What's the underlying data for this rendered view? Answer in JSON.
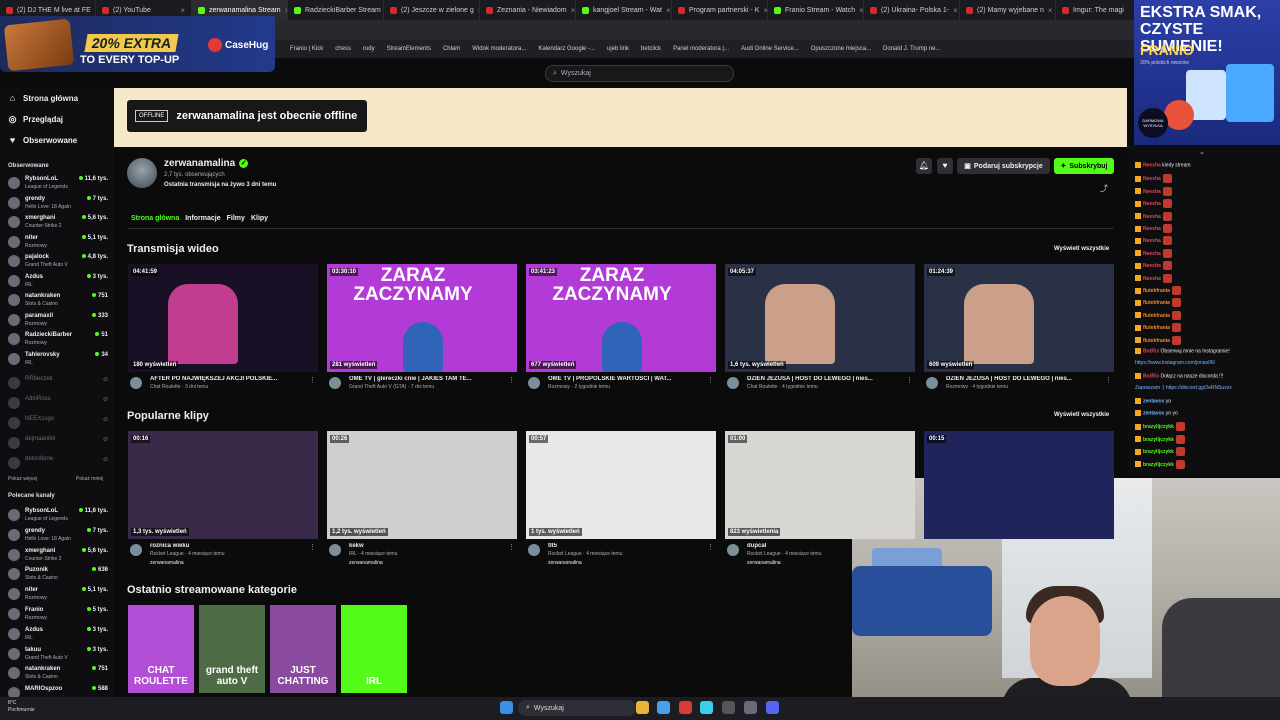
{
  "browser": {
    "tabs": [
      {
        "label": "(2) DJ THE M live at FE",
        "icon": "youtube-icon"
      },
      {
        "label": "(2) YouTube",
        "icon": "youtube-icon"
      },
      {
        "label": "zerwanamalina Stream",
        "icon": "kick-icon",
        "active": true
      },
      {
        "label": "RadzieckiBarber Stream",
        "icon": "kick-icon"
      },
      {
        "label": "(2) Jeszcze w zielone g",
        "icon": "youtube-icon"
      },
      {
        "label": "Zeznania - Niewiadom",
        "icon": "tiktok-icon"
      },
      {
        "label": "kangjoel Stream - Wat",
        "icon": "kick-icon"
      },
      {
        "label": "Program partnerski - K",
        "icon": "youtube-icon"
      },
      {
        "label": "Franio Stream - Watch",
        "icon": "kick-icon"
      },
      {
        "label": "(2) Ukraina- Polska 1-",
        "icon": "youtube-icon"
      },
      {
        "label": "(2) Mamy wyjebane n",
        "icon": "youtube-icon"
      },
      {
        "label": "Imgur: The magi",
        "icon": "imgur-icon"
      }
    ],
    "bookmarks": [
      "Franio | Kick",
      "chess",
      "rudy",
      "StreamElements",
      "Chłam",
      "Widok moderatora...",
      "Kalendarz Google -...",
      "ujeb link",
      "betclick",
      "Panel moderatora |...",
      "Audi Online Service...",
      "Opuszczone miejsca...",
      "Donald J. Trump ne..."
    ]
  },
  "promo": {
    "headline": "20% EXTRA",
    "sub": "TO EVERY TOP-UP",
    "brand": "CaseHug"
  },
  "ad": {
    "headline": "EKSTRA SMAK, CZYSTE SUMIENIE!",
    "brand": "FRANIO",
    "fine": "30% polskich owoców",
    "badge": "DARMOWA WYSYŁKA"
  },
  "search": {
    "placeholder": "Wyszukaj"
  },
  "nav": {
    "home": "Strona główna",
    "browse": "Przeglądaj",
    "following": "Obserwowane",
    "following_header": "Obserwowane",
    "show_more": "Pokaż więcej",
    "show_less": "Pokaż mniej",
    "recommended_header": "Polecane kanały",
    "followed": [
      {
        "name": "RybsonLoL",
        "category": "League of Legends",
        "viewers": "11,6 tys."
      },
      {
        "name": "grendy",
        "category": "Hello Love: 18 Again",
        "viewers": "7 tys."
      },
      {
        "name": "xmerghani",
        "category": "Counter-Strike 2",
        "viewers": "5,6 tys."
      },
      {
        "name": "niter",
        "category": "Rozmowy",
        "viewers": "5,1 tys."
      },
      {
        "name": "pajalock",
        "category": "Grand Theft Auto V",
        "viewers": "4,8 tys."
      },
      {
        "name": "Azdus",
        "category": "IRL",
        "viewers": "3 tys."
      },
      {
        "name": "natankraken",
        "category": "Slots & Casino",
        "viewers": "751"
      },
      {
        "name": "paramaxil",
        "category": "Rozmowy",
        "viewers": "333"
      },
      {
        "name": "RadzieckiBarber",
        "category": "Rozmowy",
        "viewers": "51"
      },
      {
        "name": "Tahlerovsky",
        "category": "IRL",
        "viewers": "34"
      }
    ],
    "followed_offline": [
      "RRbeczek",
      "AdinRoss",
      "NEEXcsgo",
      "dejmaanikk",
      "delordione"
    ],
    "recommended": [
      {
        "name": "RybsonLoL",
        "category": "League of Legends",
        "viewers": "11,6 tys."
      },
      {
        "name": "grendy",
        "category": "Hello Love: 18 Again",
        "viewers": "7 tys."
      },
      {
        "name": "xmerghani",
        "category": "Counter-Strike 2",
        "viewers": "5,6 tys."
      },
      {
        "name": "Puzonik",
        "category": "Slots & Casino",
        "viewers": "636"
      },
      {
        "name": "niter",
        "category": "Rozmowy",
        "viewers": "5,1 tys."
      },
      {
        "name": "Franio",
        "category": "Rozmowy",
        "viewers": "5 tys."
      },
      {
        "name": "Azdus",
        "category": "IRL",
        "viewers": "3 tys."
      },
      {
        "name": "takuu",
        "category": "Grand Theft Auto V",
        "viewers": "3 tys."
      },
      {
        "name": "natankraken",
        "category": "Slots & Casino",
        "viewers": "751"
      },
      {
        "name": "MARIOspzoo",
        "category": "",
        "viewers": "588"
      }
    ]
  },
  "channel": {
    "offline_tag": "OFFLINE",
    "offline_msg": "zerwanamalina jest obecnie offline",
    "name": "zerwanamalina",
    "followers": "2,7 tys. obserwujących",
    "last_live": "Ostatnia transmisja na żywo 3 dni temu",
    "gift_sub": "Podaruj subskrypcje",
    "subscribe": "Subskrybuj",
    "tabs": [
      "Strona główna",
      "Informacje",
      "Filmy",
      "Klipy"
    ]
  },
  "videos": {
    "title": "Transmisja wideo",
    "see_all": "Wyświetl wszystkie",
    "items": [
      {
        "duration": "04:41:59",
        "views": "180 wyświetleń",
        "title": "AFTER PO NAJWIĘKSZEJ AKCJI POLSKIE...",
        "meta": "Chat Roulette · 3 dni temu"
      },
      {
        "duration": "03:30:10",
        "views": "281 wyświetleń",
        "title": "OME TV | glereczki cnie | JAKIEŚ TAM TE...",
        "meta": "Grand Theft Auto V (GTA) · 7 dni temu",
        "overlay": "ZARAZ ZACZYNAMY"
      },
      {
        "duration": "03:41:23",
        "views": "677 wyświetleń",
        "title": "OME TV | PROPOLSKIE WARTOŚCI | WAT...",
        "meta": "Rozmowy · 2 tygodnie temu",
        "overlay": "ZARAZ ZACZYNAMY"
      },
      {
        "duration": "04:05:37",
        "views": "1,6 tys. wyświetleń",
        "title": "DZIEŃ JEZUSA | HOST DO LEWEGO | nies...",
        "meta": "Chat Roulette · 4 tygodnie temu"
      },
      {
        "duration": "01:24:39",
        "views": "609 wyświetleń",
        "title": "DZIEŃ JEZUSA | HOST DO LEWEGO | nies...",
        "meta": "Rozmowy · 4 tygodnie temu"
      }
    ]
  },
  "clips": {
    "title": "Popularne klipy",
    "see_all": "Wyświetl wszystkie",
    "items": [
      {
        "duration": "00:16",
        "views": "1,3 tys. wyświetleń",
        "title": "roznica wieku",
        "meta": "Rocket League · 4 miesiące temu",
        "author": "zerwanamalina"
      },
      {
        "duration": "00:26",
        "views": "1,2 tys. wyświetleń",
        "title": "kekw",
        "meta": "IRL · 4 miesiące temu",
        "author": "zerwanamalina"
      },
      {
        "duration": "00:57",
        "views": "1 tys. wyświetleń",
        "title": "tlt5",
        "meta": "Rocket League · 4 miesiące temu",
        "author": "zerwanamalina"
      },
      {
        "duration": "01:00",
        "views": "823 wyświetlenia",
        "title": "dupcal",
        "meta": "Rocket League · 4 miesiące temu",
        "author": "zerwanamalina"
      },
      {
        "duration": "00:15",
        "views": "",
        "title": "",
        "meta": "",
        "author": ""
      }
    ]
  },
  "categories": {
    "title": "Ostatnio streamowane kategorie",
    "items": [
      {
        "label": "CHAT ROULETTE",
        "color": "#b34fd6"
      },
      {
        "label": "grand theft auto V",
        "color": "#4d6b45"
      },
      {
        "label": "JUST CHATTING",
        "color": "#8a4a9e"
      },
      {
        "label": "IRL",
        "color": "#53fc18"
      }
    ]
  },
  "chat": {
    "messages": [
      {
        "user": "Neesha",
        "text": "kiedy stream",
        "color": "#e0465a"
      },
      {
        "user": "Neesha",
        "text": "",
        "color": "#e0465a",
        "emote": true
      },
      {
        "user": "Neesha",
        "text": "",
        "color": "#e0465a",
        "emote": true
      },
      {
        "user": "Neesha",
        "text": "",
        "color": "#e0465a",
        "emote": true
      },
      {
        "user": "Neesha",
        "text": "",
        "color": "#e0465a",
        "emote": true
      },
      {
        "user": "Neesha",
        "text": "",
        "color": "#e0465a",
        "emote": true
      },
      {
        "user": "Neesha",
        "text": "",
        "color": "#e0465a",
        "emote": true
      },
      {
        "user": "Neesha",
        "text": "",
        "color": "#e0465a",
        "emote": true
      },
      {
        "user": "Neesha",
        "text": "",
        "color": "#e0465a",
        "emote": true
      },
      {
        "user": "Neesha",
        "text": "",
        "color": "#e0465a",
        "emote": true
      },
      {
        "user": "flutekfrania",
        "text": "",
        "color": "#f08a2b",
        "emote": true
      },
      {
        "user": "flutekfrania",
        "text": "",
        "color": "#f08a2b",
        "emote": true
      },
      {
        "user": "flutekfrania",
        "text": "",
        "color": "#f08a2b",
        "emote": true
      },
      {
        "user": "flutekfrania",
        "text": "",
        "color": "#f08a2b",
        "emote": true
      },
      {
        "user": "flutekfrania",
        "text": "",
        "color": "#f08a2b",
        "emote": true
      },
      {
        "user": "BotRix",
        "text": "Obserwuj mnie na Instagramie!",
        "color": "#e0465a"
      },
      {
        "user": "",
        "text": "https://www.instagram.com/jonas06/",
        "color": "#7ab8ff",
        "link": true
      },
      {
        "user": "BotRix",
        "text": "Dołącz na nasze discorda !!!",
        "color": "#e0465a"
      },
      {
        "user": "",
        "text": "Zapraszam :) https://discord.gg/2eRNSuvxz",
        "color": "#7ab8ff",
        "link": true
      },
      {
        "user": "zentavos",
        "text": "yo",
        "color": "#7ab8ff"
      },
      {
        "user": "zentavos",
        "text": "yo yo",
        "color": "#7ab8ff"
      },
      {
        "user": "brazylijczykk",
        "text": "",
        "color": "#53fc18",
        "emote": true
      },
      {
        "user": "brazylijczykk",
        "text": "",
        "color": "#53fc18",
        "emote": true
      },
      {
        "user": "brazylijczykk",
        "text": "",
        "color": "#53fc18",
        "emote": true
      },
      {
        "user": "brazylijczykk",
        "text": "",
        "color": "#53fc18",
        "emote": true
      }
    ]
  },
  "taskbar": {
    "weather_temp": "8°C",
    "weather_desc": "Pochmurnie",
    "search": "Wyszukaj"
  }
}
